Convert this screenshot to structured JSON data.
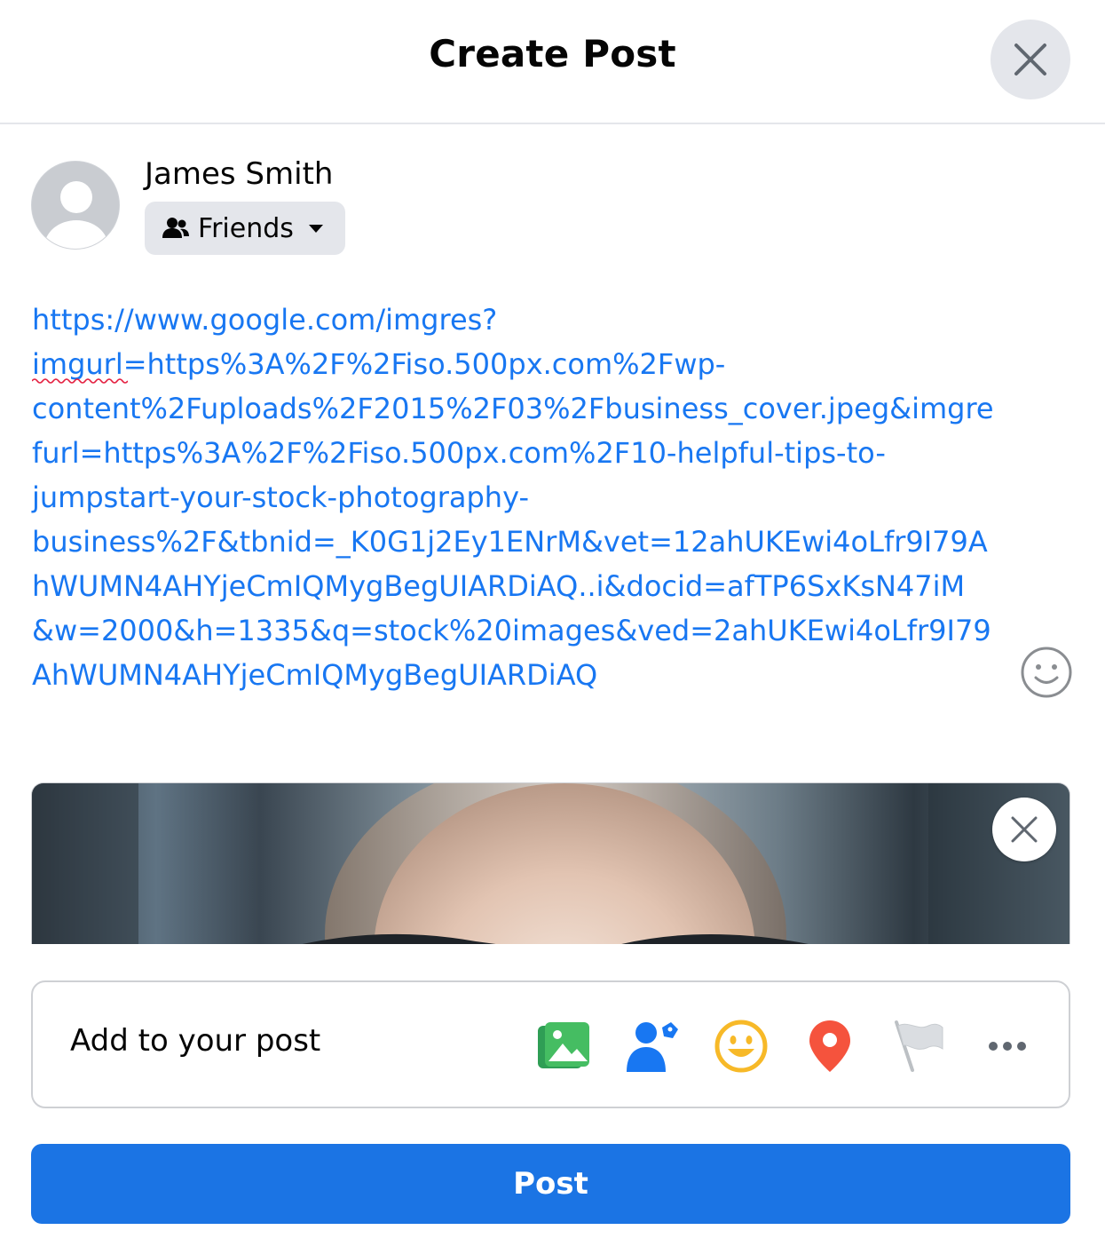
{
  "header": {
    "title": "Create Post"
  },
  "user": {
    "name": "James Smith",
    "audience": "Friends"
  },
  "composer": {
    "lines": [
      "https://www.google.com/imgres?",
      "imgurl=https%3A%2F%2Fiso.500px.com%2Fwp-",
      "content%2Fuploads%2F2015%2F03%2Fbusiness_cover.jpeg&imgre",
      "furl=https%3A%2F%2Fiso.500px.com%2F10-helpful-tips-to-",
      "jumpstart-your-stock-photography-",
      "business%2F&tbnid=_K0G1j2Ey1ENrM&vet=12ahUKEwi4oLfr9I79A",
      "hWUMN4AHYjeCmIQMygBegUIARDiAQ..i&docid=afTP6SxKsN47iM",
      "&w=2000&h=1335&q=stock%20images&ved=2ahUKEwi4oLfr9I79",
      "AhWUMN4AHYjeCmIQMygBegUIARDiAQ"
    ],
    "link_color": "#1877f2"
  },
  "add_to_post": {
    "label": "Add to your post",
    "icons": [
      "photo-video-icon",
      "tag-people-icon",
      "feeling-icon",
      "check-in-icon",
      "flag-icon",
      "more-icon"
    ]
  },
  "post_button": {
    "label": "Post",
    "color": "#1b74e4"
  }
}
